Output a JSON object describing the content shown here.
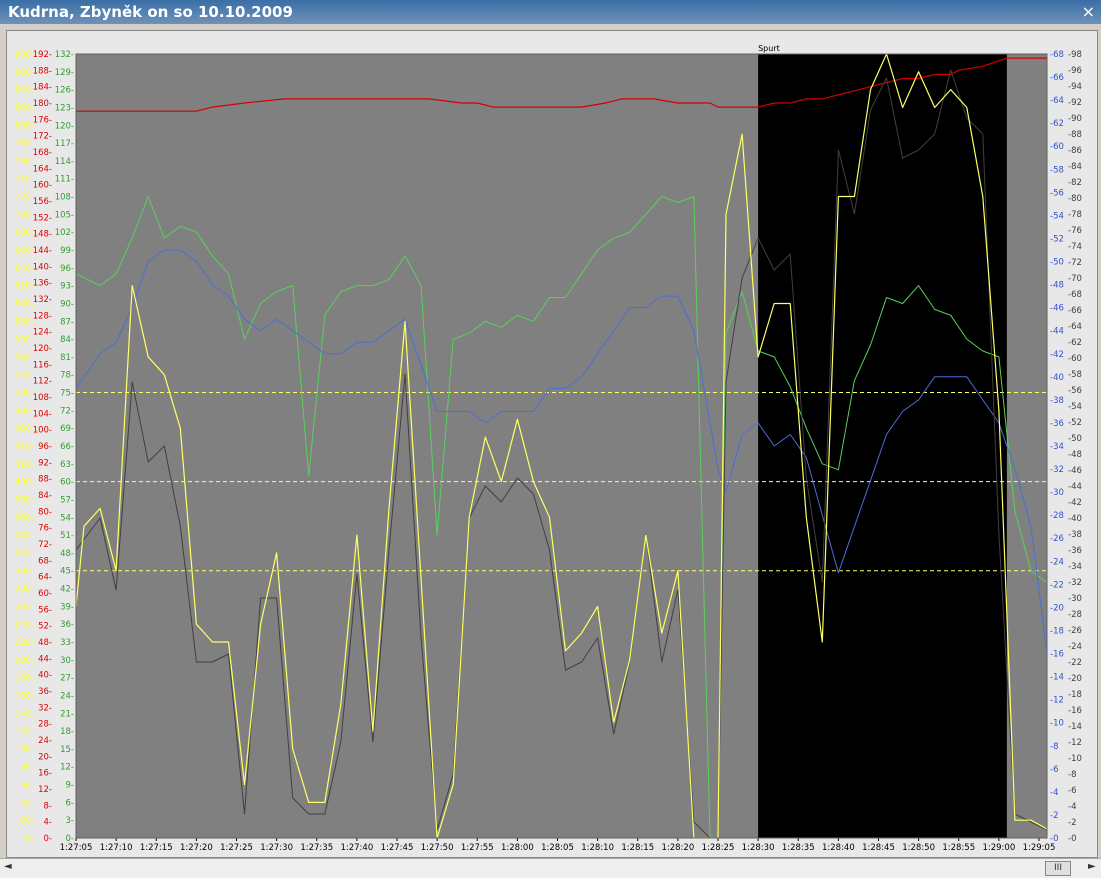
{
  "window": {
    "title": "Kudrna, Zbyněk on so 10.10.2009",
    "close_glyph": "×"
  },
  "scrollbar": {
    "left_arrow": "◄",
    "right_arrow": "►",
    "grip": "III"
  },
  "colors": {
    "plot_bg": "#808080",
    "spurt_bg": "#000000",
    "yellow": "#ffff66",
    "red": "#d40000",
    "green": "#5ad05a",
    "blue": "#4a6ed8",
    "dark": "#404040"
  },
  "chart_data": {
    "type": "line",
    "annotation": "Spurt",
    "spurt_region": {
      "start": 85,
      "end": 116
    },
    "x": {
      "min": 0,
      "max": 121
    },
    "x_ticks": [
      {
        "x": 0,
        "label": "1:27:05"
      },
      {
        "x": 5,
        "label": "1:27:10"
      },
      {
        "x": 10,
        "label": "1:27:15"
      },
      {
        "x": 15,
        "label": "1:27:20"
      },
      {
        "x": 20,
        "label": "1:27:25"
      },
      {
        "x": 25,
        "label": "1:27:30"
      },
      {
        "x": 30,
        "label": "1:27:35"
      },
      {
        "x": 35,
        "label": "1:27:40"
      },
      {
        "x": 40,
        "label": "1:27:45"
      },
      {
        "x": 45,
        "label": "1:27:50"
      },
      {
        "x": 50,
        "label": "1:27:55"
      },
      {
        "x": 55,
        "label": "1:28:00"
      },
      {
        "x": 60,
        "label": "1:28:05"
      },
      {
        "x": 65,
        "label": "1:28:10"
      },
      {
        "x": 70,
        "label": "1:28:15"
      },
      {
        "x": 75,
        "label": "1:28:20"
      },
      {
        "x": 80,
        "label": "1:28:25"
      },
      {
        "x": 85,
        "label": "1:28:30"
      },
      {
        "x": 90,
        "label": "1:28:35"
      },
      {
        "x": 95,
        "label": "1:28:40"
      },
      {
        "x": 100,
        "label": "1:28:45"
      },
      {
        "x": 105,
        "label": "1:28:50"
      },
      {
        "x": 110,
        "label": "1:28:55"
      },
      {
        "x": 115,
        "label": "1:29:00"
      },
      {
        "x": 120,
        "label": "1:29:05"
      }
    ],
    "axes": {
      "yellow": {
        "min": 0,
        "max": 880,
        "step": 20
      },
      "red": {
        "min": 0,
        "max": 192,
        "step": 4
      },
      "green": {
        "min": 0,
        "max": 132,
        "step": 3
      },
      "blue": {
        "min": 0,
        "max": 68,
        "step": 2
      },
      "gray": {
        "min": 0,
        "max": 98,
        "step": 2
      }
    },
    "reference_lines": [
      500,
      400,
      300
    ],
    "series": [
      {
        "key": "red",
        "axis": "red",
        "color": "#d40000",
        "width": 1.2,
        "points": [
          [
            0,
            178
          ],
          [
            5,
            178
          ],
          [
            10,
            178
          ],
          [
            15,
            178
          ],
          [
            17,
            179
          ],
          [
            21,
            180
          ],
          [
            26,
            181
          ],
          [
            35,
            181
          ],
          [
            44,
            181
          ],
          [
            48,
            180
          ],
          [
            50,
            180
          ],
          [
            52,
            179
          ],
          [
            60,
            179
          ],
          [
            63,
            179
          ],
          [
            66,
            180
          ],
          [
            68,
            181
          ],
          [
            70,
            181
          ],
          [
            72,
            181
          ],
          [
            75,
            180
          ],
          [
            79,
            180
          ],
          [
            80,
            179
          ],
          [
            84,
            179
          ],
          [
            85,
            179
          ],
          [
            87,
            180
          ],
          [
            89,
            180
          ],
          [
            91,
            181
          ],
          [
            93,
            181
          ],
          [
            95,
            182
          ],
          [
            97,
            183
          ],
          [
            99,
            184
          ],
          [
            101,
            185
          ],
          [
            103,
            186
          ],
          [
            105,
            186
          ],
          [
            107,
            187
          ],
          [
            109,
            187
          ],
          [
            110,
            188
          ],
          [
            113,
            189
          ],
          [
            116,
            191
          ],
          [
            121,
            191
          ]
        ]
      },
      {
        "key": "green",
        "axis": "green",
        "color": "#5ad05a",
        "width": 1,
        "points": [
          [
            0,
            95
          ],
          [
            3,
            93
          ],
          [
            5,
            95
          ],
          [
            7,
            101
          ],
          [
            9,
            108
          ],
          [
            11,
            101
          ],
          [
            13,
            103
          ],
          [
            15,
            102
          ],
          [
            17,
            98
          ],
          [
            19,
            95
          ],
          [
            21,
            84
          ],
          [
            23,
            90
          ],
          [
            25,
            92
          ],
          [
            27,
            93
          ],
          [
            29,
            61
          ],
          [
            31,
            88
          ],
          [
            33,
            92
          ],
          [
            35,
            93
          ],
          [
            37,
            93
          ],
          [
            39,
            94
          ],
          [
            41,
            98
          ],
          [
            43,
            93
          ],
          [
            45,
            51
          ],
          [
            47,
            84
          ],
          [
            49,
            85
          ],
          [
            51,
            87
          ],
          [
            53,
            86
          ],
          [
            55,
            88
          ],
          [
            57,
            87
          ],
          [
            59,
            91
          ],
          [
            61,
            91
          ],
          [
            63,
            95
          ],
          [
            65,
            99
          ],
          [
            67,
            101
          ],
          [
            69,
            102
          ],
          [
            71,
            105
          ],
          [
            73,
            108
          ],
          [
            75,
            107
          ],
          [
            77,
            108
          ],
          [
            79,
            0
          ],
          [
            80,
            0
          ],
          [
            81,
            85
          ],
          [
            83,
            92
          ],
          [
            85,
            82
          ],
          [
            87,
            81
          ],
          [
            89,
            76
          ],
          [
            91,
            69
          ],
          [
            93,
            63
          ],
          [
            95,
            62
          ],
          [
            97,
            77
          ],
          [
            99,
            83
          ],
          [
            101,
            91
          ],
          [
            103,
            90
          ],
          [
            105,
            93
          ],
          [
            107,
            89
          ],
          [
            109,
            88
          ],
          [
            111,
            84
          ],
          [
            113,
            82
          ],
          [
            115,
            81
          ],
          [
            117,
            55
          ],
          [
            119,
            45
          ],
          [
            121,
            43
          ],
          [
            121,
            0
          ]
        ]
      },
      {
        "key": "blue",
        "axis": "blue",
        "color": "#4a6ed8",
        "width": 1,
        "points": [
          [
            0,
            39
          ],
          [
            3,
            42
          ],
          [
            5,
            43
          ],
          [
            7,
            46
          ],
          [
            9,
            50
          ],
          [
            11,
            51
          ],
          [
            13,
            51
          ],
          [
            15,
            50
          ],
          [
            17,
            48
          ],
          [
            19,
            47
          ],
          [
            21,
            45
          ],
          [
            23,
            44
          ],
          [
            25,
            45
          ],
          [
            27,
            44
          ],
          [
            29,
            43
          ],
          [
            31,
            42
          ],
          [
            33,
            42
          ],
          [
            35,
            43
          ],
          [
            37,
            43
          ],
          [
            39,
            44
          ],
          [
            41,
            45
          ],
          [
            43,
            41
          ],
          [
            45,
            37
          ],
          [
            47,
            37
          ],
          [
            49,
            37
          ],
          [
            51,
            36
          ],
          [
            53,
            37
          ],
          [
            55,
            37
          ],
          [
            57,
            37
          ],
          [
            59,
            39
          ],
          [
            61,
            39
          ],
          [
            63,
            40
          ],
          [
            65,
            42
          ],
          [
            67,
            44
          ],
          [
            69,
            46
          ],
          [
            71,
            46
          ],
          [
            73,
            47
          ],
          [
            75,
            47
          ],
          [
            77,
            44
          ],
          [
            79,
            36
          ],
          [
            80,
            32
          ],
          [
            81,
            30
          ],
          [
            83,
            35
          ],
          [
            85,
            36
          ],
          [
            87,
            34
          ],
          [
            89,
            35
          ],
          [
            91,
            33
          ],
          [
            93,
            28
          ],
          [
            95,
            23
          ],
          [
            97,
            27
          ],
          [
            99,
            31
          ],
          [
            101,
            35
          ],
          [
            103,
            37
          ],
          [
            105,
            38
          ],
          [
            107,
            40
          ],
          [
            109,
            40
          ],
          [
            111,
            40
          ],
          [
            113,
            38
          ],
          [
            115,
            36
          ],
          [
            117,
            32
          ],
          [
            119,
            27
          ],
          [
            121,
            16
          ]
        ]
      },
      {
        "key": "gray",
        "axis": "gray",
        "color": "#404040",
        "width": 1,
        "points": [
          [
            0,
            36
          ],
          [
            3,
            40
          ],
          [
            5,
            31
          ],
          [
            7,
            57
          ],
          [
            9,
            47
          ],
          [
            11,
            49
          ],
          [
            13,
            39
          ],
          [
            15,
            22
          ],
          [
            17,
            22
          ],
          [
            19,
            23
          ],
          [
            21,
            3
          ],
          [
            23,
            30
          ],
          [
            25,
            30
          ],
          [
            27,
            5
          ],
          [
            29,
            3
          ],
          [
            31,
            3
          ],
          [
            33,
            12
          ],
          [
            35,
            33
          ],
          [
            37,
            12
          ],
          [
            39,
            36
          ],
          [
            41,
            58
          ],
          [
            43,
            25
          ],
          [
            45,
            1
          ],
          [
            47,
            8
          ],
          [
            49,
            40
          ],
          [
            51,
            44
          ],
          [
            53,
            42
          ],
          [
            55,
            45
          ],
          [
            57,
            43
          ],
          [
            59,
            36
          ],
          [
            61,
            21
          ],
          [
            63,
            22
          ],
          [
            65,
            25
          ],
          [
            67,
            13
          ],
          [
            69,
            22
          ],
          [
            71,
            38
          ],
          [
            73,
            22
          ],
          [
            75,
            31
          ],
          [
            77,
            2
          ],
          [
            79,
            0
          ],
          [
            80,
            0
          ],
          [
            81,
            57
          ],
          [
            83,
            70
          ],
          [
            85,
            75
          ],
          [
            87,
            71
          ],
          [
            89,
            73
          ],
          [
            91,
            45
          ],
          [
            93,
            32
          ],
          [
            95,
            86
          ],
          [
            97,
            78
          ],
          [
            99,
            91
          ],
          [
            101,
            95
          ],
          [
            103,
            85
          ],
          [
            105,
            86
          ],
          [
            107,
            88
          ],
          [
            109,
            96
          ],
          [
            111,
            90
          ],
          [
            113,
            88
          ],
          [
            115,
            38
          ],
          [
            117,
            3
          ],
          [
            119,
            2
          ],
          [
            121,
            1
          ]
        ]
      },
      {
        "key": "yellow",
        "axis": "yellow",
        "color": "#ffff66",
        "width": 1.2,
        "points": [
          [
            0,
            260
          ],
          [
            1,
            350
          ],
          [
            3,
            370
          ],
          [
            5,
            300
          ],
          [
            7,
            620
          ],
          [
            9,
            540
          ],
          [
            11,
            520
          ],
          [
            13,
            460
          ],
          [
            15,
            240
          ],
          [
            17,
            220
          ],
          [
            19,
            220
          ],
          [
            21,
            60
          ],
          [
            23,
            240
          ],
          [
            25,
            320
          ],
          [
            27,
            100
          ],
          [
            29,
            40
          ],
          [
            31,
            40
          ],
          [
            33,
            150
          ],
          [
            35,
            340
          ],
          [
            37,
            120
          ],
          [
            39,
            370
          ],
          [
            41,
            580
          ],
          [
            43,
            290
          ],
          [
            45,
            0
          ],
          [
            47,
            60
          ],
          [
            49,
            360
          ],
          [
            51,
            450
          ],
          [
            53,
            400
          ],
          [
            55,
            470
          ],
          [
            57,
            400
          ],
          [
            59,
            360
          ],
          [
            61,
            210
          ],
          [
            63,
            230
          ],
          [
            65,
            260
          ],
          [
            67,
            130
          ],
          [
            69,
            200
          ],
          [
            71,
            340
          ],
          [
            73,
            230
          ],
          [
            75,
            300
          ],
          [
            77,
            0
          ],
          [
            79,
            0
          ],
          [
            80,
            0
          ],
          [
            81,
            700
          ],
          [
            83,
            790
          ],
          [
            85,
            540
          ],
          [
            87,
            600
          ],
          [
            89,
            600
          ],
          [
            91,
            360
          ],
          [
            93,
            220
          ],
          [
            95,
            720
          ],
          [
            97,
            720
          ],
          [
            99,
            840
          ],
          [
            101,
            880
          ],
          [
            103,
            820
          ],
          [
            105,
            860
          ],
          [
            107,
            820
          ],
          [
            109,
            840
          ],
          [
            111,
            820
          ],
          [
            113,
            720
          ],
          [
            115,
            480
          ],
          [
            117,
            20
          ],
          [
            119,
            20
          ],
          [
            121,
            10
          ]
        ]
      }
    ]
  }
}
